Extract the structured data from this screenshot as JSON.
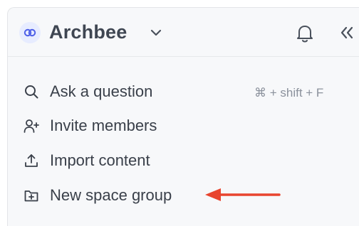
{
  "header": {
    "brand_name": "Archbee",
    "logo_icon": "archbee-logo-icon",
    "dropdown_icon": "chevron-down-icon",
    "notifications_icon": "bell-icon",
    "collapse_icon": "double-chevron-left-icon"
  },
  "menu": {
    "items": [
      {
        "label": "Ask a question",
        "icon": "search-icon",
        "shortcut": "⌘ + shift + F"
      },
      {
        "label": "Invite members",
        "icon": "add-user-icon"
      },
      {
        "label": "Import content",
        "icon": "upload-icon"
      },
      {
        "label": "New space group",
        "icon": "add-folder-icon"
      }
    ]
  },
  "annotation": {
    "arrow_color": "#e8442e",
    "arrow_target": "New space group"
  },
  "colors": {
    "panel_bg": "#f7f8fa",
    "text": "#3a404a",
    "muted": "#8b919c",
    "brand_accent": "#5a6cff"
  }
}
